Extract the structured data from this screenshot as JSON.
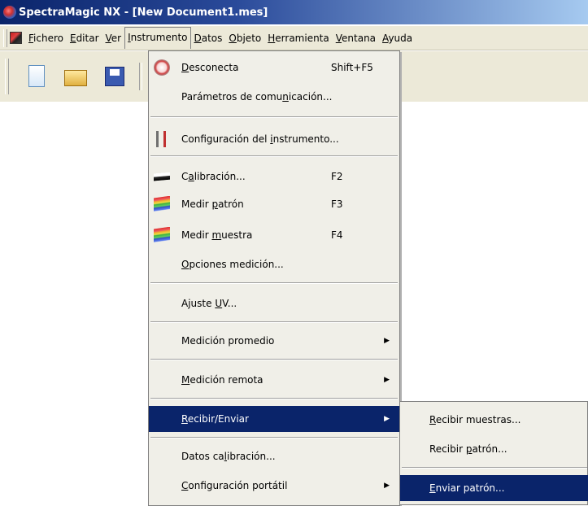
{
  "window": {
    "title": "SpectraMagic NX - [New Document1.mes]"
  },
  "menubar": {
    "items": [
      {
        "label": "Fichero",
        "ul": "F",
        "rest": "ichero"
      },
      {
        "label": "Editar",
        "ul": "E",
        "rest": "ditar"
      },
      {
        "label": "Ver",
        "ul": "V",
        "rest": "er"
      },
      {
        "label": "Instrumento",
        "ul": "I",
        "rest": "nstrumento"
      },
      {
        "label": "Datos",
        "ul": "D",
        "rest": "atos"
      },
      {
        "label": "Objeto",
        "ul": "O",
        "rest": "bjeto"
      },
      {
        "label": "Herramienta",
        "ul": "H",
        "rest": "erramienta"
      },
      {
        "label": "Ventana",
        "ul": "V",
        "rest": "entana"
      },
      {
        "label": "Ayuda",
        "ul": "A",
        "rest": "yuda"
      }
    ]
  },
  "toolbar": {
    "icons": [
      "new-document-icon",
      "open-folder-icon",
      "save-icon",
      "disconnect-icon"
    ]
  },
  "instrument_menu": {
    "items": [
      {
        "pre": "",
        "ul": "D",
        "post": "esconecta",
        "shortcut": "Shift+F5",
        "icon": "disconnect-icon"
      },
      {
        "pre": "Parámetros de comu",
        "ul": "n",
        "post": "icación...",
        "shortcut": "",
        "icon": ""
      },
      {
        "pre": "Configuración del ",
        "ul": "i",
        "post": "nstrumento...",
        "shortcut": "",
        "icon": "tools-icon"
      },
      {
        "pre": "C",
        "ul": "a",
        "post": "libración...",
        "shortcut": "F2",
        "icon": "calibration-plate-icon"
      },
      {
        "pre": "Medir ",
        "ul": "p",
        "post": "atrón",
        "shortcut": "F3",
        "icon": "color-stack-icon"
      },
      {
        "pre": "Medir ",
        "ul": "m",
        "post": "uestra",
        "shortcut": "F4",
        "icon": "color-stack-icon"
      },
      {
        "pre": "",
        "ul": "O",
        "post": "pciones medición...",
        "shortcut": "",
        "icon": ""
      },
      {
        "pre": "Ajuste ",
        "ul": "U",
        "post": "V...",
        "shortcut": "",
        "icon": ""
      },
      {
        "pre": "Medición promedio",
        "ul": "",
        "post": "",
        "shortcut": "",
        "icon": "",
        "submenu": true
      },
      {
        "pre": "",
        "ul": "M",
        "post": "edición remota",
        "shortcut": "",
        "icon": "",
        "submenu": true
      },
      {
        "pre": "",
        "ul": "R",
        "post": "ecibir/Enviar",
        "shortcut": "",
        "icon": "",
        "submenu": true,
        "highlighted": true
      },
      {
        "pre": "Datos ca",
        "ul": "l",
        "post": "ibración...",
        "shortcut": "",
        "icon": ""
      },
      {
        "pre": "",
        "ul": "C",
        "post": "onfiguración portátil",
        "shortcut": "",
        "icon": "",
        "submenu": true
      }
    ]
  },
  "recibir_enviar_submenu": {
    "items": [
      {
        "pre": "",
        "ul": "R",
        "post": "ecibir muestras...",
        "highlighted": false
      },
      {
        "pre": "Recibir ",
        "ul": "p",
        "post": "atrón...",
        "highlighted": false
      },
      {
        "pre": "",
        "ul": "E",
        "post": "nviar patrón...",
        "highlighted": true
      }
    ]
  },
  "colors": {
    "highlight": "#0a246a",
    "menu_bg": "#f0efe8",
    "chrome": "#ece9d8"
  }
}
